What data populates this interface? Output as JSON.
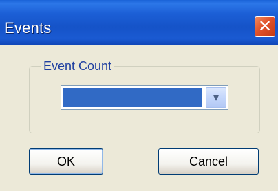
{
  "window": {
    "title": "Events",
    "close_glyph": "✕"
  },
  "group": {
    "legend": "Event Count"
  },
  "combo": {
    "selected_value": "",
    "arrow_glyph": "▾"
  },
  "buttons": {
    "ok_label": "OK",
    "cancel_label": "Cancel"
  },
  "colors": {
    "title_bar": "#1553c8",
    "selection": "#316ac5",
    "dialog_bg": "#ece9d8"
  }
}
